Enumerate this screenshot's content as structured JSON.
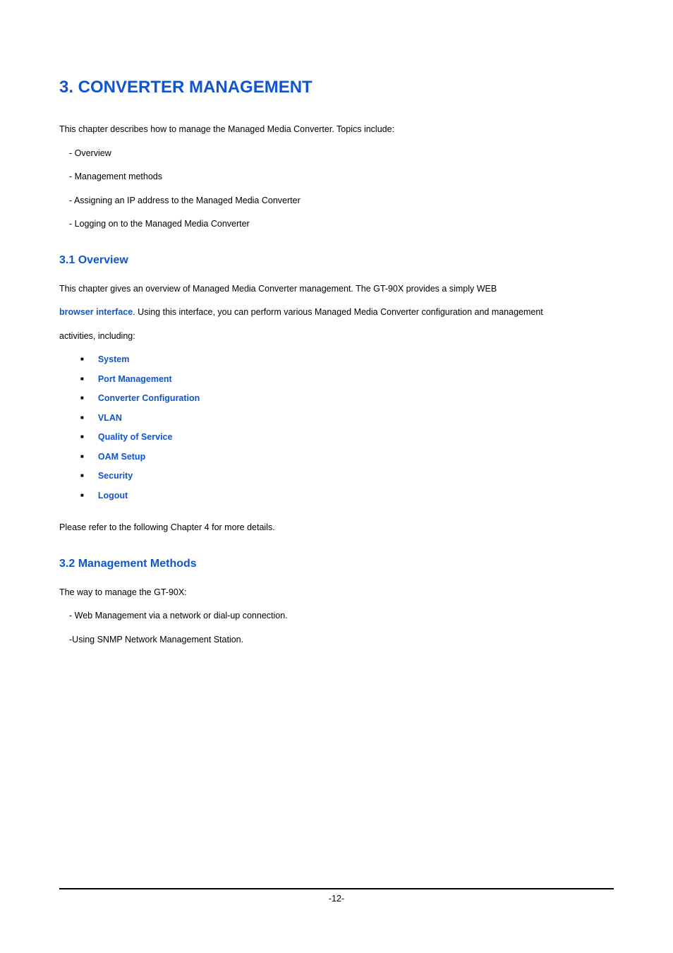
{
  "heading1": "3. CONVERTER MANAGEMENT",
  "intro_text": "This chapter describes how to manage the Managed Media Converter. Topics include:",
  "intro_items": {
    "i1": "- Overview",
    "i2": "- Management methods",
    "i3": "- Assigning an IP address to the Managed Media Converter",
    "i4": "- Logging on to the Managed Media Converter"
  },
  "section31": {
    "heading": "3.1 Overview",
    "p1_a": "This chapter gives an overview of Managed Media Converter management. The GT-90X provides a simply WEB",
    "p1_b_blue": "browser interface",
    "p1_c": ". Using this interface, you can perform various Managed Media Converter configuration and management",
    "p1_d": "activities, including:",
    "bullets": {
      "b1": "System",
      "b2": "Port Management",
      "b3": "Converter Configuration",
      "b4": "VLAN",
      "b5": "Quality of Service",
      "b6": "OAM Setup",
      "b7": "Security",
      "b8": "Logout"
    },
    "p2": "Please refer to the following Chapter 4 for more details."
  },
  "section32": {
    "heading": "3.2 Management Methods",
    "p1": "The way to manage the GT-90X:",
    "items": {
      "i1": "- Web Management via a network or dial-up connection.",
      "i2": "-Using SNMP Network Management Station."
    }
  },
  "page_number": "-12-"
}
